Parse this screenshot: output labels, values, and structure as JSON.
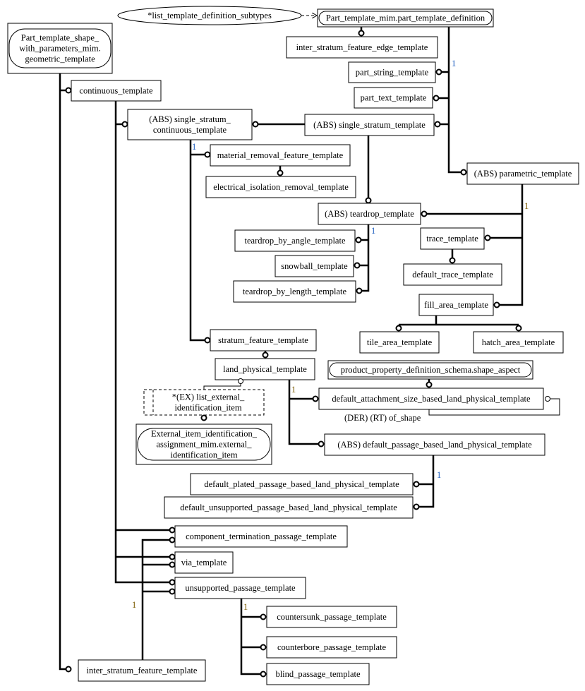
{
  "colors": {
    "card_blue": "#1f5fbf",
    "card_brown": "#7a5a00",
    "line": "#000000"
  },
  "nodes": [
    {
      "id": "geometric_template",
      "lines": [
        "Part_template_shape_",
        "with_parameters_mim.",
        "geometric_template"
      ],
      "kind": "external"
    },
    {
      "id": "list_template_definition_subtypes",
      "lines": [
        "*list_template_definition_subtypes"
      ],
      "kind": "ellipse"
    },
    {
      "id": "part_template_definition",
      "lines": [
        "Part_template_mim.part_template_definition"
      ],
      "kind": "external"
    },
    {
      "id": "inter_stratum_feature_edge_template",
      "lines": [
        "inter_stratum_feature_edge_template"
      ],
      "kind": "entity"
    },
    {
      "id": "part_string_template",
      "lines": [
        "part_string_template"
      ],
      "kind": "entity"
    },
    {
      "id": "part_text_template",
      "lines": [
        "part_text_template"
      ],
      "kind": "entity"
    },
    {
      "id": "single_stratum_template",
      "lines": [
        "(ABS) single_stratum_template"
      ],
      "kind": "entity"
    },
    {
      "id": "parametric_template",
      "lines": [
        "(ABS) parametric_template"
      ],
      "kind": "entity"
    },
    {
      "id": "continuous_template",
      "lines": [
        "continuous_template"
      ],
      "kind": "entity"
    },
    {
      "id": "single_stratum_continuous_template",
      "lines": [
        "(ABS) single_stratum_",
        "continuous_template"
      ],
      "kind": "entity"
    },
    {
      "id": "material_removal_feature_template",
      "lines": [
        "material_removal_feature_template"
      ],
      "kind": "entity"
    },
    {
      "id": "electrical_isolation_removal_template",
      "lines": [
        "electrical_isolation_removal_template"
      ],
      "kind": "entity"
    },
    {
      "id": "teardrop_template",
      "lines": [
        "(ABS) teardrop_template"
      ],
      "kind": "entity"
    },
    {
      "id": "teardrop_by_angle_template",
      "lines": [
        "teardrop_by_angle_template"
      ],
      "kind": "entity"
    },
    {
      "id": "snowball_template",
      "lines": [
        "snowball_template"
      ],
      "kind": "entity"
    },
    {
      "id": "teardrop_by_length_template",
      "lines": [
        "teardrop_by_length_template"
      ],
      "kind": "entity"
    },
    {
      "id": "trace_template",
      "lines": [
        "trace_template"
      ],
      "kind": "entity"
    },
    {
      "id": "default_trace_template",
      "lines": [
        "default_trace_template"
      ],
      "kind": "entity"
    },
    {
      "id": "fill_area_template",
      "lines": [
        "fill_area_template"
      ],
      "kind": "entity"
    },
    {
      "id": "tile_area_template",
      "lines": [
        "tile_area_template"
      ],
      "kind": "entity"
    },
    {
      "id": "hatch_area_template",
      "lines": [
        "hatch_area_template"
      ],
      "kind": "entity"
    },
    {
      "id": "stratum_feature_template",
      "lines": [
        "stratum_feature_template"
      ],
      "kind": "entity"
    },
    {
      "id": "land_physical_template",
      "lines": [
        "land_physical_template"
      ],
      "kind": "entity"
    },
    {
      "id": "shape_aspect",
      "lines": [
        "product_property_definition_schema.shape_aspect"
      ],
      "kind": "external"
    },
    {
      "id": "default_attachment_size_based_land_physical_template",
      "lines": [
        "default_attachment_size_based_land_physical_template"
      ],
      "kind": "entity"
    },
    {
      "id": "list_external_identification_item",
      "lines": [
        "*(EX) list_external_",
        "identification_item"
      ],
      "kind": "dashed"
    },
    {
      "id": "external_identification_item",
      "lines": [
        "External_item_identification_",
        "assignment_mim.external_",
        "identification_item"
      ],
      "kind": "external"
    },
    {
      "id": "default_passage_based_land_physical_template",
      "lines": [
        "(ABS) default_passage_based_land_physical_template"
      ],
      "kind": "entity"
    },
    {
      "id": "default_plated_passage_based_land_physical_template",
      "lines": [
        "default_plated_passage_based_land_physical_template"
      ],
      "kind": "entity"
    },
    {
      "id": "default_unsupported_passage_based_land_physical_template",
      "lines": [
        "default_unsupported_passage_based_land_physical_template"
      ],
      "kind": "entity"
    },
    {
      "id": "component_termination_passage_template",
      "lines": [
        "component_termination_passage_template"
      ],
      "kind": "entity"
    },
    {
      "id": "via_template",
      "lines": [
        "via_template"
      ],
      "kind": "entity"
    },
    {
      "id": "unsupported_passage_template",
      "lines": [
        "unsupported_passage_template"
      ],
      "kind": "entity"
    },
    {
      "id": "countersunk_passage_template",
      "lines": [
        "countersunk_passage_template"
      ],
      "kind": "entity"
    },
    {
      "id": "counterbore_passage_template",
      "lines": [
        "counterbore_passage_template"
      ],
      "kind": "entity"
    },
    {
      "id": "blind_passage_template",
      "lines": [
        "blind_passage_template"
      ],
      "kind": "entity"
    },
    {
      "id": "inter_stratum_feature_template",
      "lines": [
        "inter_stratum_feature_template"
      ],
      "kind": "entity"
    }
  ],
  "attribute_labels": [
    {
      "id": "of_shape",
      "text": "(DER) (RT) of_shape"
    }
  ],
  "cardinalities": [
    {
      "text": "1",
      "color": "blue"
    },
    {
      "text": "1",
      "color": "brown"
    },
    {
      "text": "1",
      "color": "blue"
    },
    {
      "text": "1",
      "color": "blue"
    },
    {
      "text": "1",
      "color": "brown"
    },
    {
      "text": "1",
      "color": "blue"
    },
    {
      "text": "1",
      "color": "brown"
    },
    {
      "text": "1",
      "color": "brown"
    }
  ]
}
